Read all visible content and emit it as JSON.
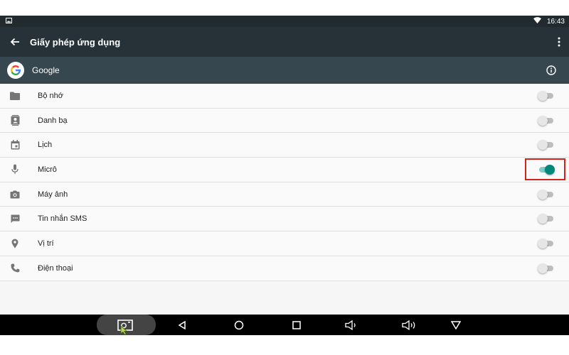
{
  "status_bar": {
    "time": "16:43"
  },
  "app_bar": {
    "title": "Giấy phép ứng dụng"
  },
  "app_header": {
    "app_name": "Google"
  },
  "permissions": [
    {
      "label": "Bộ nhớ",
      "icon": "folder-icon",
      "enabled": false
    },
    {
      "label": "Danh bạ",
      "icon": "contacts-icon",
      "enabled": false
    },
    {
      "label": "Lịch",
      "icon": "calendar-icon",
      "enabled": false
    },
    {
      "label": "Micrô",
      "icon": "microphone-icon",
      "enabled": true
    },
    {
      "label": "Máy ảnh",
      "icon": "camera-icon",
      "enabled": false
    },
    {
      "label": "Tin nhắn SMS",
      "icon": "sms-icon",
      "enabled": false
    },
    {
      "label": "Vị trí",
      "icon": "location-icon",
      "enabled": false
    },
    {
      "label": "Điện thoại",
      "icon": "phone-icon",
      "enabled": false
    }
  ],
  "colors": {
    "app_bar": "#263238",
    "app_header": "#37474f",
    "accent": "#00897b",
    "highlight_box": "#d0241c"
  }
}
